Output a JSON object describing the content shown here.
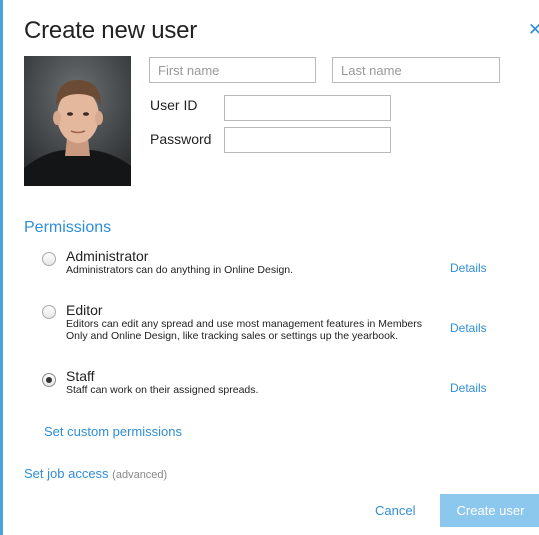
{
  "dialog": {
    "title": "Create new user",
    "close_icon": "close-icon"
  },
  "form": {
    "first_name": {
      "value": "",
      "placeholder": "First name"
    },
    "last_name": {
      "value": "",
      "placeholder": "Last name"
    },
    "user_id_label": "User ID",
    "password_label": "Password"
  },
  "permissions": {
    "heading": "Permissions",
    "roles": [
      {
        "name": "Administrator",
        "description": "Administrators can do anything in Online Design.",
        "details": "Details",
        "selected": false
      },
      {
        "name": "Editor",
        "description": "Editors can edit any spread and use most management features in Members Only and Online Design, like tracking sales or settings up the yearbook.",
        "details": "Details",
        "selected": false
      },
      {
        "name": "Staff",
        "description": "Staff can work on their assigned spreads.",
        "details": "Details",
        "selected": true
      }
    ],
    "custom_link": "Set custom permissions"
  },
  "job_access": {
    "link": "Set job access",
    "note": "(advanced)"
  },
  "footer": {
    "cancel": "Cancel",
    "create": "Create user"
  },
  "colors": {
    "accent": "#2f8ed6",
    "primary_button": "#8cc7ee",
    "border": "#4aa3df"
  }
}
